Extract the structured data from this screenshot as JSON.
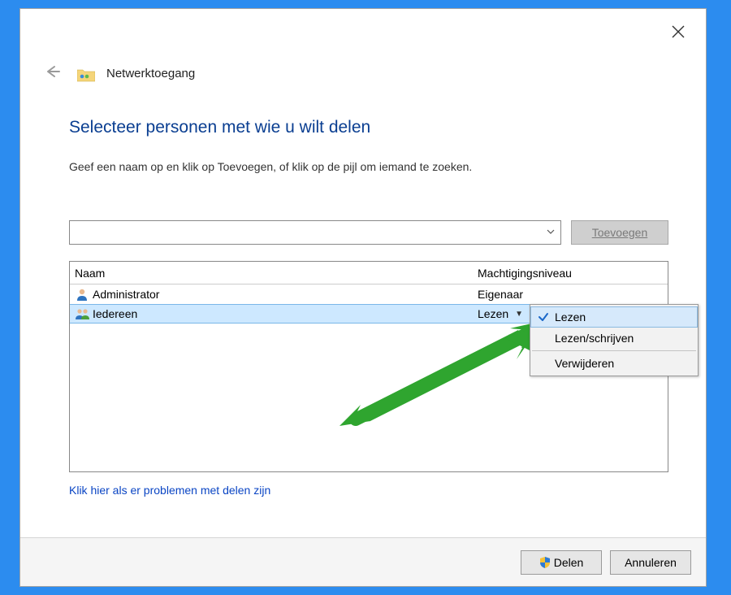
{
  "header": {
    "title": "Netwerktoegang"
  },
  "content": {
    "heading": "Selecteer personen met wie u wilt delen",
    "sub": "Geef een naam op en klik op Toevoegen, of klik op de pijl om iemand te zoeken.",
    "add_label": "Toevoegen",
    "name_input_value": ""
  },
  "table": {
    "col_name": "Naam",
    "col_perm": "Machtigingsniveau",
    "rows": [
      {
        "name": "Administrator",
        "perm": "Eigenaar"
      },
      {
        "name": "Iedereen",
        "perm": "Lezen"
      }
    ]
  },
  "menu": {
    "read": "Lezen",
    "readwrite": "Lezen/schrijven",
    "remove": "Verwijderen"
  },
  "trouble_link": "Klik hier als er problemen met delen zijn",
  "footer": {
    "share": "Delen",
    "cancel": "Annuleren"
  }
}
